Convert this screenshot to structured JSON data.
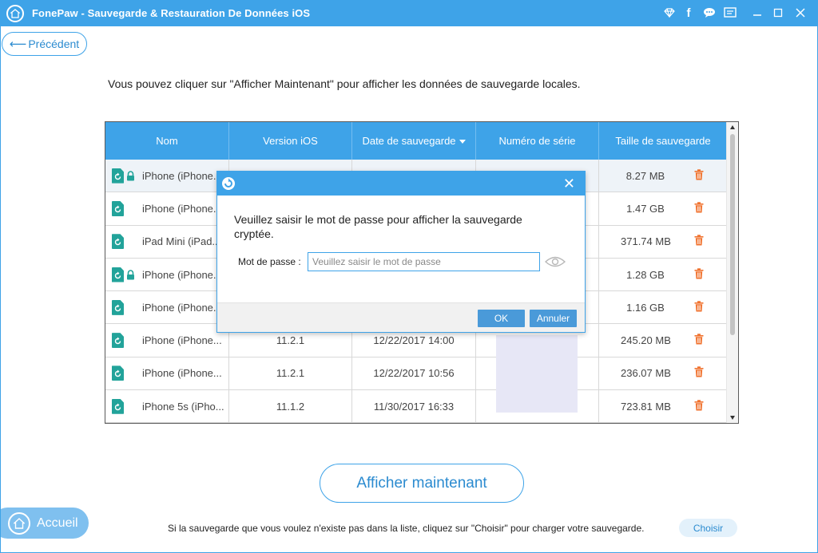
{
  "app": {
    "title": "FonePaw - Sauvegarde & Restauration De Données iOS"
  },
  "nav": {
    "back_label": "Précédent",
    "home_label": "Accueil"
  },
  "instruction": "Vous pouvez cliquer sur \"Afficher Maintenant\" pour afficher les données de sauvegarde locales.",
  "table": {
    "columns": [
      "Nom",
      "Version iOS",
      "Date de sauvegarde",
      "Numéro de série",
      "Taille de sauvegarde"
    ],
    "sorted_column": "Date de sauvegarde",
    "rows": [
      {
        "name": "iPhone (iPhone...",
        "locked": true,
        "ios": "",
        "date": "",
        "serial": "",
        "size": "8.27 MB"
      },
      {
        "name": "iPhone (iPhone...",
        "locked": false,
        "ios": "",
        "date": "",
        "serial": "",
        "size": "1.47 GB"
      },
      {
        "name": "iPad Mini (iPad...",
        "locked": false,
        "ios": "",
        "date": "",
        "serial": "",
        "size": "371.74 MB"
      },
      {
        "name": "iPhone (iPhone...",
        "locked": true,
        "ios": "",
        "date": "",
        "serial": "",
        "size": "1.28 GB"
      },
      {
        "name": "iPhone (iPhone...",
        "locked": false,
        "ios": "",
        "date": "",
        "serial": "",
        "size": "1.16 GB"
      },
      {
        "name": "iPhone (iPhone...",
        "locked": false,
        "ios": "11.2.1",
        "date": "12/22/2017 14:00",
        "serial": "",
        "size": "245.20 MB"
      },
      {
        "name": "iPhone (iPhone...",
        "locked": false,
        "ios": "11.2.1",
        "date": "12/22/2017 10:56",
        "serial": "",
        "size": "236.07 MB"
      },
      {
        "name": "iPhone 5s (iPho...",
        "locked": false,
        "ios": "11.1.2",
        "date": "11/30/2017 16:33",
        "serial": "",
        "size": "723.81 MB"
      }
    ]
  },
  "modal": {
    "message": "Veuillez saisir le mot de passe pour afficher la sauvegarde cryptée.",
    "password_label": "Mot de passe :",
    "password_placeholder": "Veuillez saisir le mot de passe",
    "ok_label": "OK",
    "cancel_label": "Annuler"
  },
  "actions": {
    "show_now_label": "Afficher maintenant",
    "bottom_hint": "Si la sauvegarde que vous voulez n'existe pas dans la liste, cliquez sur \"Choisir\" pour charger votre sauvegarde.",
    "choose_label": "Choisir"
  },
  "colors": {
    "accent": "#3ea3e8",
    "file_icon": "#22a39a",
    "trash": "#f0722e"
  },
  "icons": [
    "app-logo-icon",
    "diamond-icon",
    "facebook-icon",
    "chat-icon",
    "feedback-icon",
    "minimize-icon",
    "maximize-icon",
    "close-icon",
    "file-icon",
    "lock-icon",
    "trash-icon",
    "eye-icon",
    "home-icon"
  ]
}
